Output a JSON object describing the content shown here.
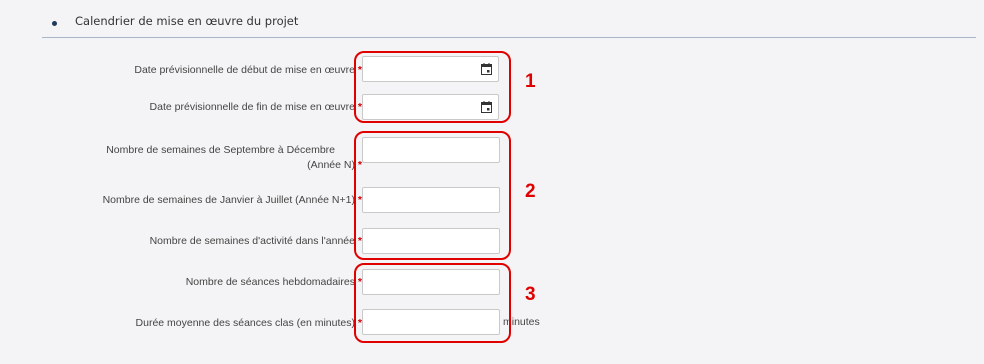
{
  "section": {
    "title": "Calendrier de mise en œuvre du projet"
  },
  "fields": {
    "date_debut": {
      "label": "Date prévisionnelle de début de mise en œuvre",
      "required_mark": "*",
      "value": ""
    },
    "date_fin": {
      "label": "Date prévisionnelle de fin de mise en œuvre",
      "required_mark": "*",
      "value": ""
    },
    "semaines_sept_dec": {
      "label_line1": "Nombre de semaines de Septembre à Décembre",
      "label_line2": "(Année N)",
      "required_mark": "*",
      "value": ""
    },
    "semaines_jan_juil": {
      "label": "Nombre de semaines de Janvier à Juillet (Année N+1)",
      "required_mark": "*",
      "value": ""
    },
    "semaines_activite": {
      "label": "Nombre de semaines d'activité dans l'année",
      "required_mark": "*",
      "value": ""
    },
    "seances_hebdo": {
      "label": "Nombre de séances hebdomadaires",
      "required_mark": "*",
      "value": ""
    },
    "duree_seances": {
      "label": "Durée moyenne des séances clas (en minutes)",
      "required_mark": "*",
      "value": "",
      "unit": "minutes"
    }
  },
  "annotations": [
    {
      "number": "1",
      "color": "#e00000"
    },
    {
      "number": "2",
      "color": "#e00000"
    },
    {
      "number": "3",
      "color": "#e00000"
    }
  ],
  "icons": [
    "calendar-icon",
    "calendar-icon"
  ]
}
